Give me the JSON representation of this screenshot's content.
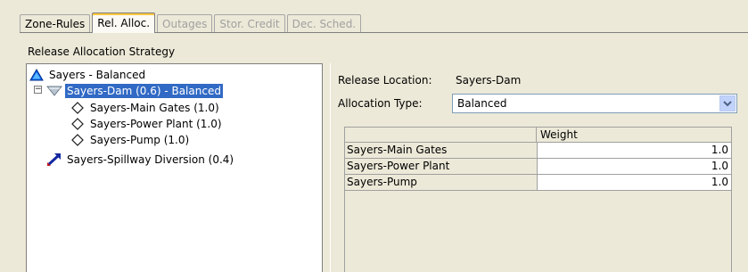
{
  "tabs": [
    {
      "label": "Zone-Rules",
      "state": "normal"
    },
    {
      "label": "Rel. Alloc.",
      "state": "active"
    },
    {
      "label": "Outages",
      "state": "disabled"
    },
    {
      "label": "Stor. Credit",
      "state": "disabled"
    },
    {
      "label": "Dec. Sched.",
      "state": "disabled"
    }
  ],
  "section_label": "Release Allocation Strategy",
  "tree": {
    "root": {
      "label": "Sayers - Balanced",
      "icon": "blue-triangle-icon"
    },
    "dam": {
      "label": "Sayers-Dam (0.6) - Balanced",
      "icon": "reservoir-icon",
      "expander": "−",
      "selected": true
    },
    "children": [
      {
        "label": "Sayers-Main Gates (1.0)",
        "icon": "diamond-outlet-icon"
      },
      {
        "label": "Sayers-Power Plant (1.0)",
        "icon": "diamond-outlet-icon"
      },
      {
        "label": "Sayers-Pump (1.0)",
        "icon": "diamond-outlet-icon"
      }
    ],
    "diversion": {
      "label": "Sayers-Spillway Diversion (0.4)",
      "icon": "diversion-icon"
    }
  },
  "details": {
    "release_location_label": "Release Location:",
    "release_location_value": "Sayers-Dam",
    "allocation_type_label": "Allocation Type:",
    "allocation_type_value": "Balanced"
  },
  "table": {
    "column_header": "Weight",
    "rows": [
      {
        "name": "Sayers-Main Gates",
        "weight": "1.0"
      },
      {
        "name": "Sayers-Power Plant",
        "weight": "1.0"
      },
      {
        "name": "Sayers-Pump",
        "weight": "1.0"
      }
    ]
  },
  "colors": {
    "background": "#ece9d8",
    "selection": "#316ac5",
    "active_tab_accent": "#ffc83c",
    "triangle_blue": "#0a64f0"
  }
}
